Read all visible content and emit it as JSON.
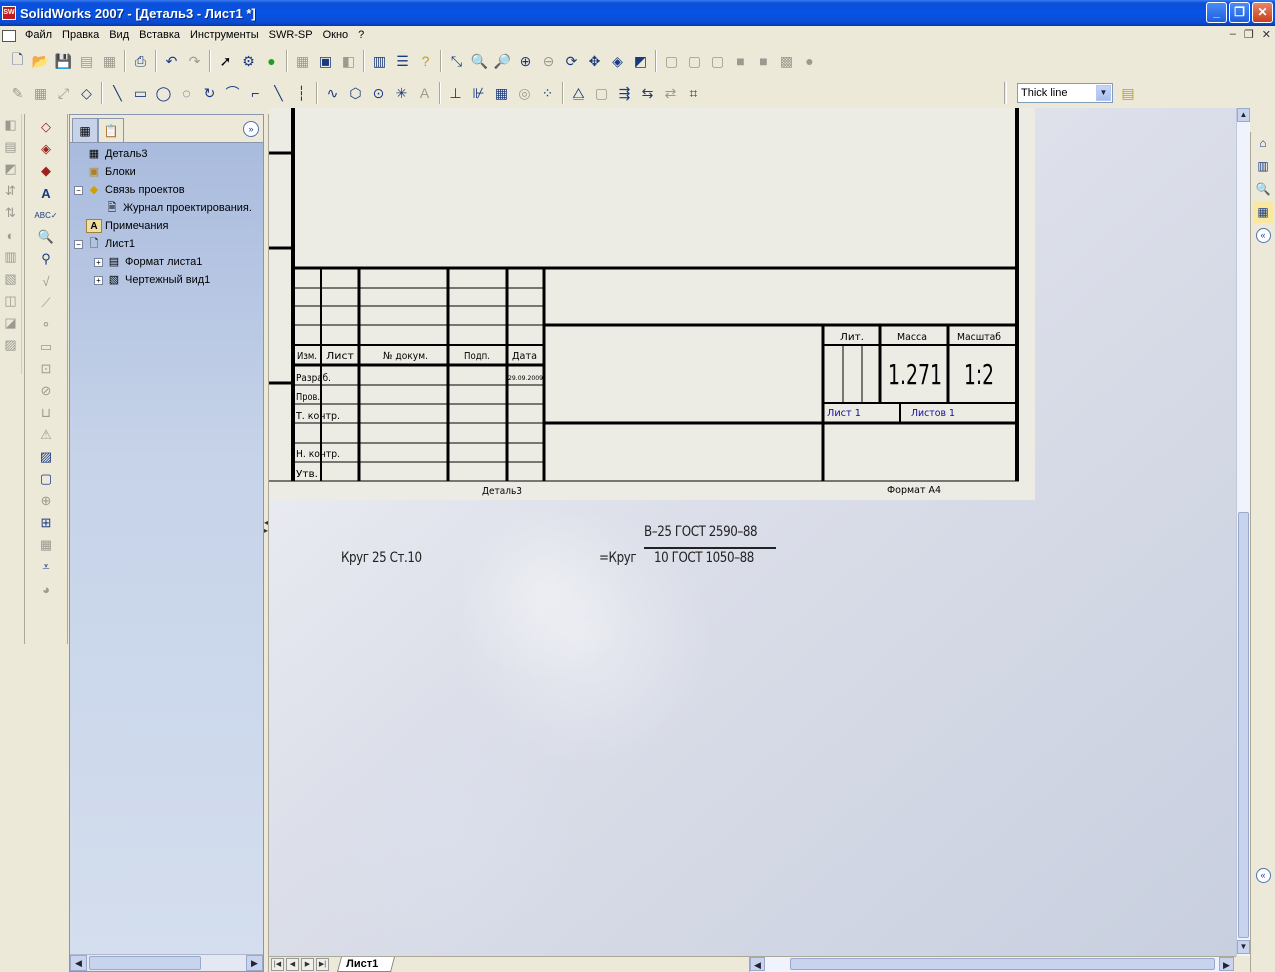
{
  "window": {
    "title": "SolidWorks 2007 - [Деталь3 - Лист1 *]",
    "app_icon_text": "SW",
    "minimize": "_",
    "restore": "❐",
    "close": "✕"
  },
  "menu": {
    "items": [
      "Файл",
      "Правка",
      "Вид",
      "Вставка",
      "Инструменты",
      "SWR-SP",
      "Окно",
      "?"
    ],
    "mdi_minimize": "–",
    "mdi_restore": "❐",
    "mdi_close": "✕"
  },
  "line_style": {
    "selected": "Thick line"
  },
  "feature_manager": {
    "tree": [
      {
        "label": "Деталь3",
        "icon": "drawing-doc-icon",
        "expander": "",
        "indent": 0
      },
      {
        "label": "Блоки",
        "icon": "blocks-folder-icon",
        "expander": "",
        "indent": 1
      },
      {
        "label": "Связь проектов",
        "icon": "design-binder-icon",
        "expander": "−",
        "indent": 0
      },
      {
        "label": "Журнал проектирования.",
        "icon": "journal-doc-icon",
        "expander": "",
        "indent": 2
      },
      {
        "label": "Примечания",
        "icon": "annotations-icon",
        "expander": "",
        "indent": 1
      },
      {
        "label": "Лист1",
        "icon": "sheet-icon",
        "expander": "−",
        "indent": 0
      },
      {
        "label": "Формат листа1",
        "icon": "sheet-format-icon",
        "expander": "+",
        "indent": 1
      },
      {
        "label": "Чертежный вид1",
        "icon": "drawing-view-icon",
        "expander": "+",
        "indent": 1
      }
    ]
  },
  "title_block": {
    "col_izm": "Изм.",
    "col_list": "Лист",
    "col_ndoc": "№ докум.",
    "col_podp": "Подп.",
    "col_data": "Дата",
    "razrab": "Разраб.",
    "date_value": "29.09.2009",
    "prov": "Пров.",
    "tkontr": "Т. контр.",
    "nkontr": "Н. контр.",
    "utv": "Утв.",
    "lit": "Лит.",
    "massa": "Масса",
    "masshtab": "Масштаб",
    "mass_value": "1.271",
    "scale_value": "1:2",
    "sheet_label": "Лист 1",
    "sheets_label": "Листов 1",
    "below_left": "Деталь3",
    "below_right": "Формат А4"
  },
  "notes": {
    "left": "Круг 25 Ст.10",
    "frac_prefix": "=Круг",
    "frac_numerator": "В–25 ГОСТ 2590–88",
    "frac_denominator": "10 ГОСТ 1050–88"
  },
  "sheet_tabs": {
    "active": "Лист1"
  }
}
